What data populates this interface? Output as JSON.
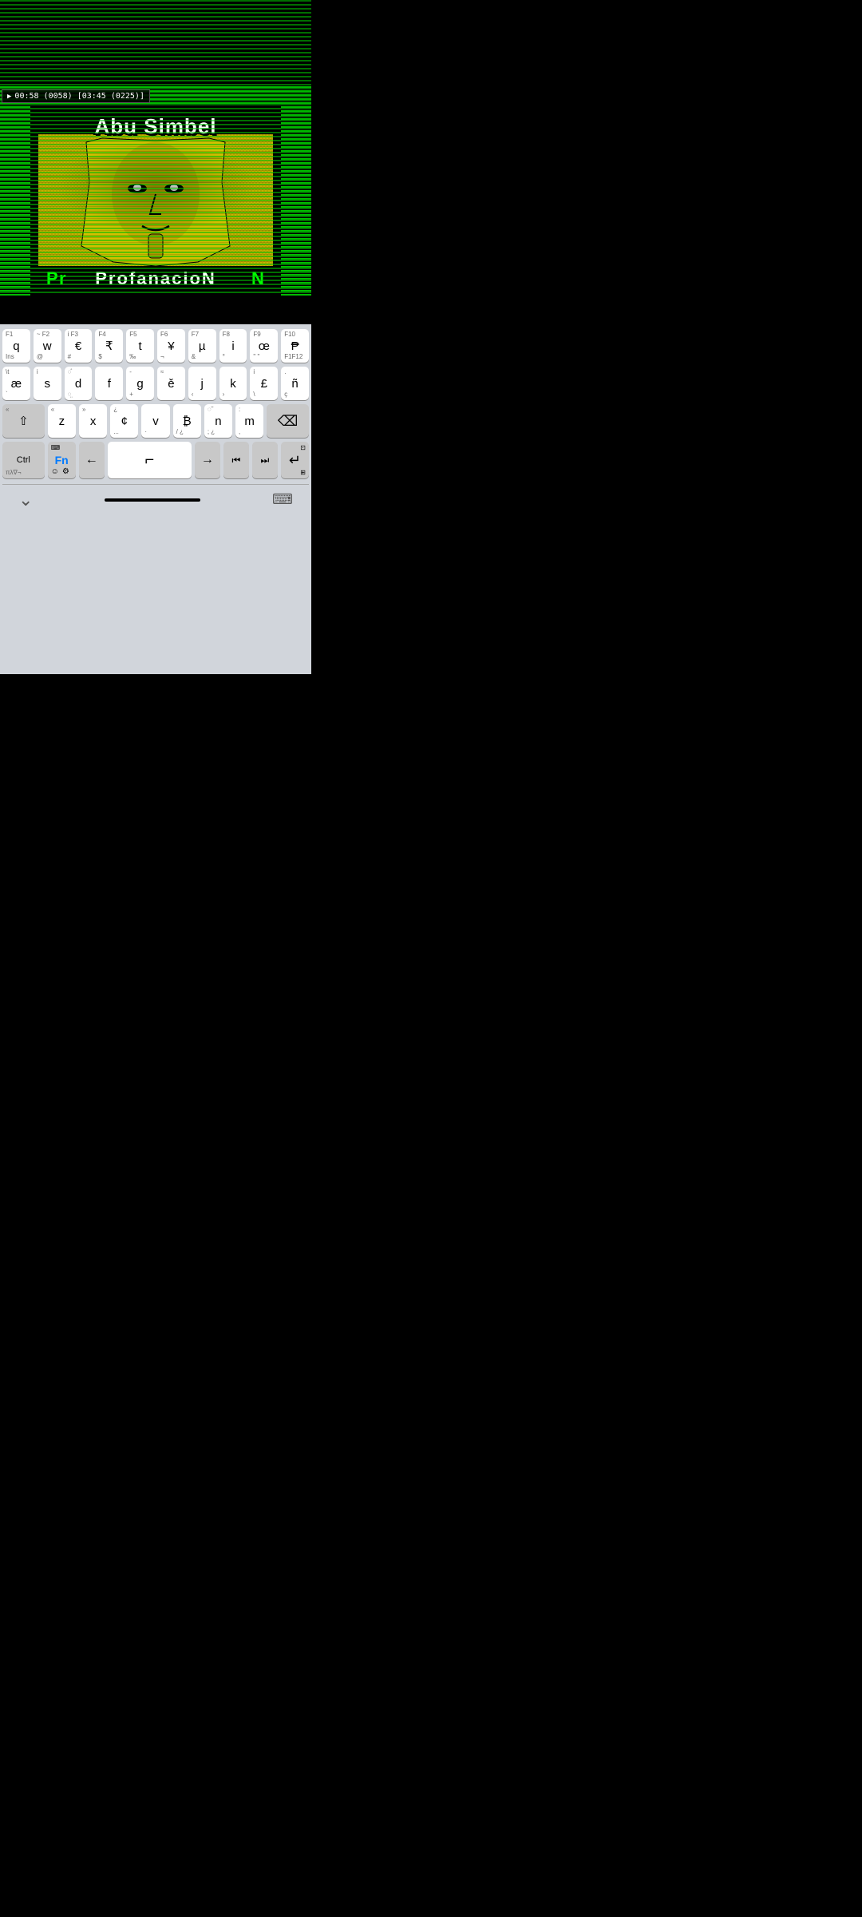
{
  "transport": {
    "play_icon": "▶",
    "time_display": "00:58 (0058) [03:45 (0225)]"
  },
  "game": {
    "title": "Abu Simbel",
    "subtitle_parts": [
      "Pr",
      "o",
      "f",
      "a",
      "n",
      "a",
      "ci",
      "o",
      "N"
    ],
    "subtitle_text": "ProfanacioN"
  },
  "keyboard": {
    "row1": [
      {
        "top": "F1",
        "main": "q",
        "bottom": "Ins"
      },
      {
        "top": "~ F2",
        "main": "w",
        "bottom": "@"
      },
      {
        "top": "i F3",
        "main": "€",
        "bottom": "#"
      },
      {
        "top": "F4",
        "main": "₹",
        "bottom": "$"
      },
      {
        "top": "F5",
        "main": "t",
        "bottom": "‰"
      },
      {
        "top": "F6",
        "main": "¥",
        "bottom": "¬"
      },
      {
        "top": "F7",
        "main": "µ",
        "bottom": "&"
      },
      {
        "top": "F8",
        "main": "i",
        "bottom": "°"
      },
      {
        "top": "F9",
        "main": "œ",
        "bottom": "\" \""
      },
      {
        "top": "F10",
        "main": "₱",
        "bottom": "F1F12"
      }
    ],
    "row2": [
      {
        "top": "\\t",
        "main": "æ",
        "bottom": "`"
      },
      {
        "top": "i",
        "main": "s",
        "bottom": ""
      },
      {
        "top": "◌̊",
        "main": "d",
        "bottom": "◌̤"
      },
      {
        "top": "",
        "main": "f",
        "bottom": ""
      },
      {
        "top": "-",
        "main": "g",
        "bottom": "+"
      },
      {
        "top": "≈",
        "main": "ě",
        "bottom": ""
      },
      {
        "top": "",
        "main": "j",
        "bottom": "‹"
      },
      {
        "top": "",
        "main": "k",
        "bottom": "›"
      },
      {
        "top": "i",
        "main": "£",
        "bottom": "\\"
      },
      {
        "top": ".",
        "main": "ñ",
        "bottom": "ç"
      }
    ],
    "row3_shift": "⇧",
    "row3": [
      {
        "top": "«",
        "main": "z",
        "bottom": ""
      },
      {
        "top": "»",
        "main": "x",
        "bottom": ""
      },
      {
        "top": "¿",
        "main": "¢",
        "bottom": "..."
      },
      {
        "top": "",
        "main": "v",
        "bottom": "·"
      },
      {
        "top": "",
        "main": "₿",
        "bottom": "/ ¿"
      },
      {
        "top": "◌̃",
        "main": "n",
        "bottom": "; ¿"
      },
      {
        "top": ":",
        "main": "m",
        "bottom": ","
      },
      {
        "top": "\"",
        "main": "",
        "bottom": ""
      }
    ],
    "row4": {
      "ctrl": "Ctrl",
      "ctrl_sub": "πλ∇¬",
      "fn": "Fn",
      "keyboard_icon": "⌨",
      "emoji_icon": "☺",
      "settings_icon": "⚙",
      "arrow_left": "←",
      "space_icon": "⌐",
      "arrow_right": "→",
      "media_prev": "⏮",
      "media_next": "⏭",
      "return": "↵",
      "resize_top": "⊡",
      "resize_bottom": "⊞"
    }
  },
  "bottom_nav": {
    "chevron_down": "⌄",
    "keyboard_icon": "⌨"
  }
}
